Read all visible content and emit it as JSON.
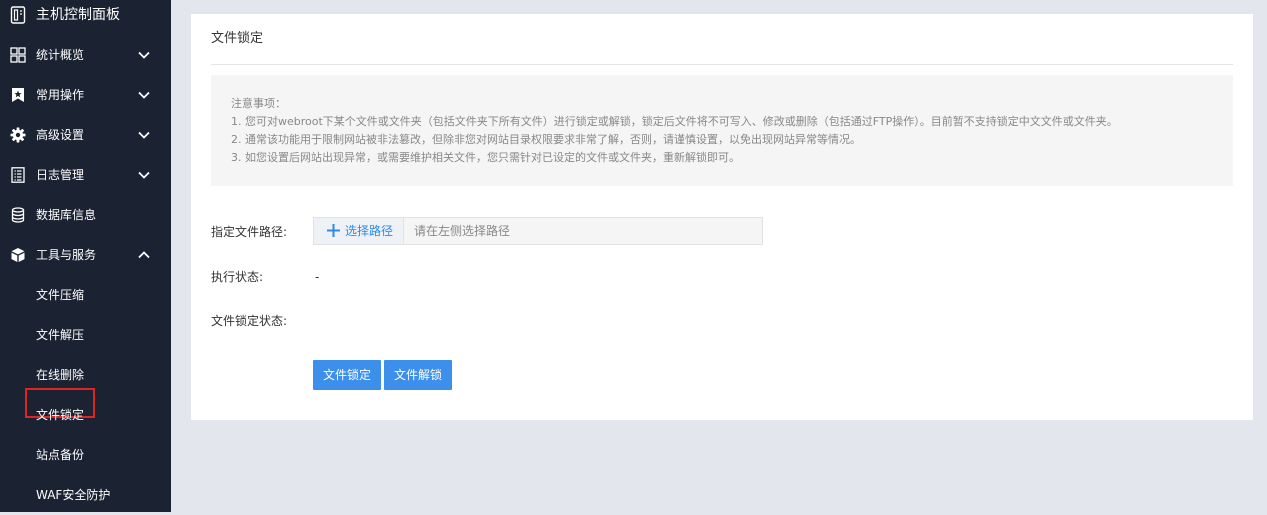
{
  "sidebar": {
    "header": "主机控制面板",
    "items": [
      {
        "label": "统计概览",
        "icon": "grid-icon",
        "expanded": false
      },
      {
        "label": "常用操作",
        "icon": "bookmark-star-icon",
        "expanded": false
      },
      {
        "label": "高级设置",
        "icon": "gear-icon",
        "expanded": false
      },
      {
        "label": "日志管理",
        "icon": "log-list-icon",
        "expanded": false
      },
      {
        "label": "数据库信息",
        "icon": "database-icon"
      },
      {
        "label": "工具与服务",
        "icon": "box-icon",
        "expanded": true
      }
    ],
    "sub_items": [
      {
        "label": "文件压缩"
      },
      {
        "label": "文件解压"
      },
      {
        "label": "在线删除"
      },
      {
        "label": "文件锁定",
        "active": true
      },
      {
        "label": "站点备份"
      },
      {
        "label": "WAF安全防护"
      }
    ]
  },
  "main": {
    "title": "文件锁定",
    "notice": {
      "heading": "注意事项：",
      "lines": [
        "1. 您可对webroot下某个文件或文件夹（包括文件夹下所有文件）进行锁定或解锁，锁定后文件将不可写入、修改或删除（包括通过FTP操作）。目前暂不支持锁定中文文件或文件夹。",
        "2. 通常该功能用于限制网站被非法篡改，但除非您对网站目录权限要求非常了解，否则，请谨慎设置，以免出现网站异常等情况。",
        "3. 如您设置后网站出现异常，或需要维护相关文件，您只需针对已设定的文件或文件夹，重新解锁即可。"
      ]
    },
    "form": {
      "path_label": "指定文件路径:",
      "select_path_button": "选择路径",
      "path_placeholder": "请在左侧选择路径",
      "exec_status_label": "执行状态:",
      "exec_status_value": "-",
      "lock_status_label": "文件锁定状态:",
      "lock_button": "文件锁定",
      "unlock_button": "文件解锁"
    }
  },
  "colors": {
    "sidebar_bg": "#1b2232",
    "page_bg": "#e4e6ed",
    "primary_button": "#3d8fec",
    "link_blue": "#2f8be6",
    "active_outline": "#e02424"
  }
}
